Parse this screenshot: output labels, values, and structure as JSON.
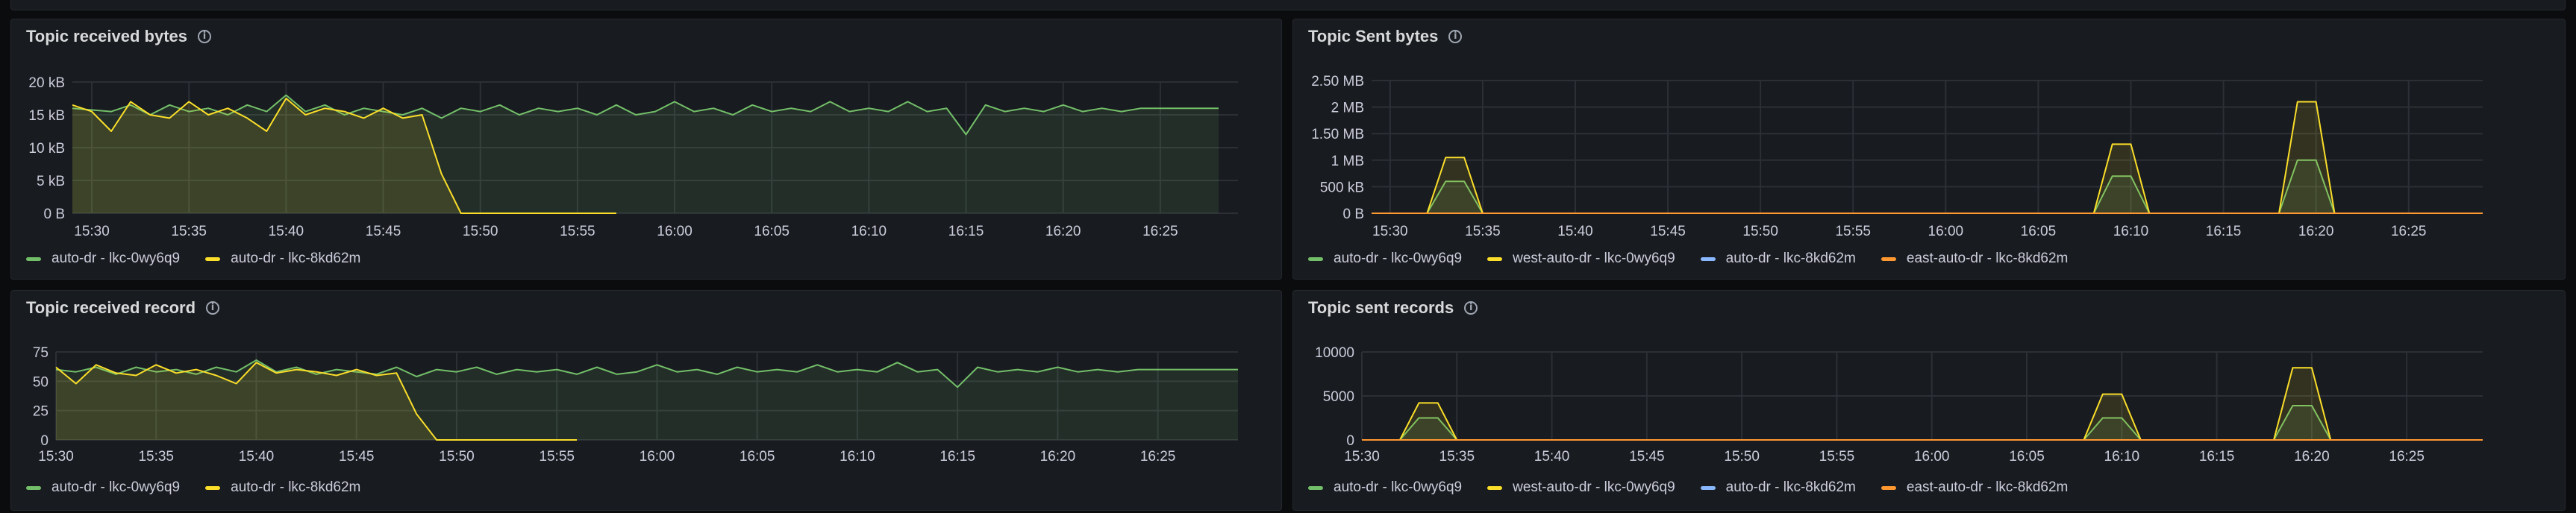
{
  "colors": {
    "green": "#73bf69",
    "yellow": "#fade2a",
    "blue": "#8ab8ff",
    "orange": "#ff9830"
  },
  "panels": [
    {
      "title": "Topic received bytes",
      "icon": "info-icon",
      "chart_data": {
        "type": "area",
        "title": "Topic received bytes",
        "y_ticks": [
          "20 kB",
          "15 kB",
          "10 kB",
          "5 kB",
          "0 B"
        ],
        "ylim": [
          0,
          20000
        ],
        "x_ticks": [
          "15:30",
          "15:35",
          "15:40",
          "15:45",
          "15:50",
          "15:55",
          "16:00",
          "16:05",
          "16:10",
          "16:15",
          "16:20",
          "16:25"
        ],
        "xlim": [
          "15:29",
          "16:29"
        ],
        "grid": true,
        "legend_position": "bottom",
        "series": [
          {
            "name": "auto-dr - lkc-0wy6q9",
            "color": "green",
            "x": [
              "15:29",
              "15:31",
              "15:32",
              "15:33",
              "15:34",
              "15:35",
              "15:36",
              "15:37",
              "15:38",
              "15:39",
              "15:40",
              "15:41",
              "15:42",
              "15:43",
              "15:44",
              "15:45",
              "15:46",
              "15:47",
              "15:48",
              "15:49",
              "15:50",
              "15:51",
              "15:52",
              "15:53",
              "15:54",
              "15:55",
              "15:56",
              "15:57",
              "15:58",
              "15:59",
              "16:00",
              "16:01",
              "16:02",
              "16:03",
              "16:04",
              "16:05",
              "16:06",
              "16:07",
              "16:08",
              "16:09",
              "16:10",
              "16:11",
              "16:12",
              "16:13",
              "16:14",
              "16:15",
              "16:16",
              "16:17",
              "16:18",
              "16:19",
              "16:20",
              "16:21",
              "16:22",
              "16:23",
              "16:24",
              "16:25",
              "16:26",
              "16:27",
              "16:28"
            ],
            "values": [
              16000,
              15500,
              16500,
              15000,
              16500,
              15500,
              16000,
              15000,
              16500,
              15500,
              18000,
              15500,
              16500,
              15000,
              16000,
              15500,
              15000,
              16000,
              14500,
              16000,
              15500,
              16500,
              15000,
              16000,
              15500,
              16000,
              15000,
              16500,
              15000,
              15500,
              17000,
              15500,
              16000,
              15000,
              16500,
              15500,
              16000,
              15500,
              17000,
              15500,
              16000,
              15500,
              17000,
              15500,
              16000,
              12000,
              16500,
              15500,
              16000,
              15500,
              16500,
              15500,
              16000,
              15500,
              16000,
              16000,
              16000,
              16000,
              16000
            ]
          },
          {
            "name": "auto-dr - lkc-8kd62m",
            "color": "yellow",
            "x": [
              "15:29",
              "15:30",
              "15:31",
              "15:32",
              "15:33",
              "15:34",
              "15:35",
              "15:36",
              "15:37",
              "15:38",
              "15:39",
              "15:40",
              "15:41",
              "15:42",
              "15:43",
              "15:44",
              "15:45",
              "15:46",
              "15:47",
              "15:48",
              "15:49",
              "15:50",
              "15:51",
              "15:52",
              "15:53",
              "15:54",
              "15:55",
              "15:56",
              "15:57"
            ],
            "values": [
              16500,
              15500,
              12500,
              17000,
              15000,
              14500,
              17000,
              15000,
              16000,
              14500,
              12500,
              17500,
              15000,
              16000,
              15500,
              14500,
              16000,
              14500,
              15000,
              6000,
              0,
              0,
              0,
              0,
              0,
              0,
              0,
              0,
              0
            ]
          }
        ]
      },
      "legend": [
        {
          "label": "auto-dr - lkc-0wy6q9",
          "color": "green"
        },
        {
          "label": "auto-dr - lkc-8kd62m",
          "color": "yellow"
        }
      ]
    },
    {
      "title": "Topic Sent bytes",
      "icon": "info-icon",
      "chart_data": {
        "type": "area",
        "title": "Topic Sent bytes",
        "y_ticks": [
          "2.50 MB",
          "2 MB",
          "1.50 MB",
          "1 MB",
          "500 kB",
          "0 B"
        ],
        "ylim": [
          0,
          2500000
        ],
        "x_ticks": [
          "15:30",
          "15:35",
          "15:40",
          "15:45",
          "15:50",
          "15:55",
          "16:00",
          "16:05",
          "16:10",
          "16:15",
          "16:20",
          "16:25"
        ],
        "xlim": [
          "15:29",
          "16:29"
        ],
        "grid": true,
        "legend_position": "bottom",
        "series": [
          {
            "name": "auto-dr - lkc-0wy6q9",
            "color": "green",
            "x": [
              "15:29",
              "15:32",
              "15:33",
              "15:34",
              "15:35",
              "16:08",
              "16:09",
              "16:10",
              "16:11",
              "16:18",
              "16:19",
              "16:20",
              "16:21",
              "16:29"
            ],
            "values": [
              0,
              0,
              600000,
              600000,
              0,
              0,
              700000,
              700000,
              0,
              0,
              1000000,
              1000000,
              0,
              0
            ]
          },
          {
            "name": "west-auto-dr - lkc-0wy6q9",
            "color": "yellow",
            "x": [
              "15:29",
              "15:32",
              "15:33",
              "15:34",
              "15:35",
              "16:08",
              "16:09",
              "16:10",
              "16:11",
              "16:18",
              "16:19",
              "16:20",
              "16:21",
              "16:29"
            ],
            "values": [
              0,
              0,
              1050000,
              1050000,
              0,
              0,
              1300000,
              1300000,
              0,
              0,
              2100000,
              2100000,
              0,
              0
            ]
          },
          {
            "name": "auto-dr - lkc-8kd62m",
            "color": "blue",
            "x": [
              "15:29",
              "16:29"
            ],
            "values": [
              0,
              0
            ]
          },
          {
            "name": "east-auto-dr - lkc-8kd62m",
            "color": "orange",
            "x": [
              "15:29",
              "16:29"
            ],
            "values": [
              0,
              0
            ]
          }
        ]
      },
      "legend": [
        {
          "label": "auto-dr - lkc-0wy6q9",
          "color": "green"
        },
        {
          "label": "west-auto-dr - lkc-0wy6q9",
          "color": "yellow"
        },
        {
          "label": "auto-dr - lkc-8kd62m",
          "color": "blue"
        },
        {
          "label": "east-auto-dr - lkc-8kd62m",
          "color": "orange"
        }
      ]
    },
    {
      "title": "Topic received record",
      "icon": "info-icon",
      "chart_data": {
        "type": "area",
        "title": "Topic received record",
        "y_ticks": [
          "75",
          "50",
          "25",
          "0"
        ],
        "ylim": [
          0,
          75
        ],
        "x_ticks": [
          "15:30",
          "15:35",
          "15:40",
          "15:45",
          "15:50",
          "15:55",
          "16:00",
          "16:05",
          "16:10",
          "16:15",
          "16:20",
          "16:25"
        ],
        "xlim": [
          "15:30",
          "16:29"
        ],
        "grid": true,
        "legend_position": "bottom",
        "series": [
          {
            "name": "auto-dr - lkc-0wy6q9",
            "color": "green",
            "x": [
              "15:30",
              "15:31",
              "15:32",
              "15:33",
              "15:34",
              "15:35",
              "15:36",
              "15:37",
              "15:38",
              "15:39",
              "15:40",
              "15:41",
              "15:42",
              "15:43",
              "15:44",
              "15:45",
              "15:46",
              "15:47",
              "15:48",
              "15:49",
              "15:50",
              "15:51",
              "15:52",
              "15:53",
              "15:54",
              "15:55",
              "15:56",
              "15:57",
              "15:58",
              "15:59",
              "16:00",
              "16:01",
              "16:02",
              "16:03",
              "16:04",
              "16:05",
              "16:06",
              "16:07",
              "16:08",
              "16:09",
              "16:10",
              "16:11",
              "16:12",
              "16:13",
              "16:14",
              "16:15",
              "16:16",
              "16:17",
              "16:18",
              "16:19",
              "16:20",
              "16:21",
              "16:22",
              "16:23",
              "16:24",
              "16:25",
              "16:26",
              "16:27",
              "16:28",
              "16:29"
            ],
            "values": [
              60,
              58,
              62,
              56,
              62,
              58,
              60,
              56,
              62,
              58,
              68,
              58,
              62,
              56,
              60,
              58,
              56,
              62,
              54,
              60,
              58,
              62,
              56,
              60,
              58,
              60,
              56,
              62,
              56,
              58,
              64,
              58,
              60,
              56,
              62,
              58,
              60,
              58,
              64,
              58,
              60,
              58,
              66,
              58,
              60,
              45,
              62,
              58,
              60,
              58,
              62,
              58,
              60,
              58,
              60,
              60,
              60,
              60,
              60,
              60
            ]
          },
          {
            "name": "auto-dr - lkc-8kd62m",
            "color": "yellow",
            "x": [
              "15:30",
              "15:31",
              "15:32",
              "15:33",
              "15:34",
              "15:35",
              "15:36",
              "15:37",
              "15:38",
              "15:39",
              "15:40",
              "15:41",
              "15:42",
              "15:43",
              "15:44",
              "15:45",
              "15:46",
              "15:47",
              "15:48",
              "15:49",
              "15:50",
              "15:51",
              "15:52",
              "15:53",
              "15:54",
              "15:55",
              "15:56"
            ],
            "values": [
              62,
              48,
              64,
              57,
              55,
              64,
              57,
              60,
              55,
              48,
              66,
              57,
              60,
              58,
              55,
              60,
              55,
              57,
              22,
              0,
              0,
              0,
              0,
              0,
              0,
              0,
              0
            ]
          }
        ]
      },
      "legend": [
        {
          "label": "auto-dr - lkc-0wy6q9",
          "color": "green"
        },
        {
          "label": "auto-dr - lkc-8kd62m",
          "color": "yellow"
        }
      ]
    },
    {
      "title": "Topic sent records",
      "icon": "info-icon",
      "chart_data": {
        "type": "area",
        "title": "Topic sent records",
        "y_ticks": [
          "10000",
          "5000",
          "0"
        ],
        "ylim": [
          0,
          10000
        ],
        "x_ticks": [
          "15:30",
          "15:35",
          "15:40",
          "15:45",
          "15:50",
          "15:55",
          "16:00",
          "16:05",
          "16:10",
          "16:15",
          "16:20",
          "16:25"
        ],
        "xlim": [
          "15:30",
          "16:29"
        ],
        "grid": true,
        "legend_position": "bottom",
        "series": [
          {
            "name": "auto-dr - lkc-0wy6q9",
            "color": "green",
            "x": [
              "15:30",
              "15:32",
              "15:33",
              "15:34",
              "15:35",
              "16:08",
              "16:09",
              "16:10",
              "16:11",
              "16:18",
              "16:19",
              "16:20",
              "16:21",
              "16:29"
            ],
            "values": [
              0,
              0,
              2500,
              2500,
              0,
              0,
              2500,
              2500,
              0,
              0,
              3900,
              3900,
              0,
              0
            ]
          },
          {
            "name": "west-auto-dr - lkc-0wy6q9",
            "color": "yellow",
            "x": [
              "15:30",
              "15:32",
              "15:33",
              "15:34",
              "15:35",
              "16:08",
              "16:09",
              "16:10",
              "16:11",
              "16:18",
              "16:19",
              "16:20",
              "16:21",
              "16:29"
            ],
            "values": [
              0,
              0,
              4200,
              4200,
              0,
              0,
              5200,
              5200,
              0,
              0,
              8200,
              8200,
              0,
              0
            ]
          },
          {
            "name": "auto-dr - lkc-8kd62m",
            "color": "blue",
            "x": [
              "15:30",
              "16:29"
            ],
            "values": [
              0,
              0
            ]
          },
          {
            "name": "east-auto-dr - lkc-8kd62m",
            "color": "orange",
            "x": [
              "15:30",
              "16:29"
            ],
            "values": [
              0,
              0
            ]
          }
        ]
      },
      "legend": [
        {
          "label": "auto-dr - lkc-0wy6q9",
          "color": "green"
        },
        {
          "label": "west-auto-dr - lkc-0wy6q9",
          "color": "yellow"
        },
        {
          "label": "auto-dr - lkc-8kd62m",
          "color": "blue"
        },
        {
          "label": "east-auto-dr - lkc-8kd62m",
          "color": "orange"
        }
      ]
    }
  ]
}
